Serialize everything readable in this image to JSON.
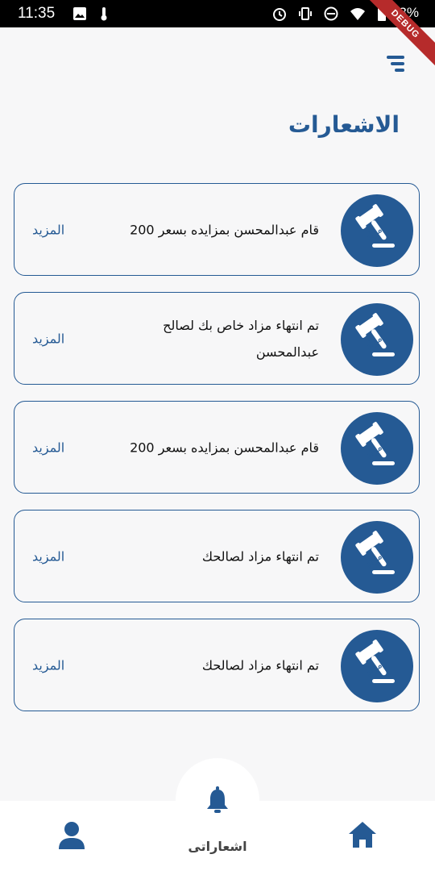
{
  "status_bar": {
    "time": "11:35",
    "battery": "83%",
    "debug_banner": "DEBUG"
  },
  "header": {
    "title": "الاشعارات",
    "menu_icon": "menu-icon"
  },
  "notifications": [
    {
      "text": "قام عبدالمحسن بمزايده بسعر 200",
      "more_label": "المزيد"
    },
    {
      "text": "تم انتهاء مزاد خاص بك لصالح عبدالمحسن",
      "more_label": "المزيد"
    },
    {
      "text": "قام عبدالمحسن بمزايده بسعر 200",
      "more_label": "المزيد"
    },
    {
      "text": "تم انتهاء مزاد لصالحك",
      "more_label": "المزيد"
    },
    {
      "text": "تم انتهاء مزاد لصالحك",
      "more_label": "المزيد"
    }
  ],
  "auction_icon_text": "مزاد",
  "bottom_nav": {
    "notifications_label": "اشعاراتى",
    "icons": [
      "profile-icon",
      "bell-icon",
      "home-icon"
    ]
  },
  "colors": {
    "primary": "#255a94",
    "background": "#f7f7f8"
  }
}
